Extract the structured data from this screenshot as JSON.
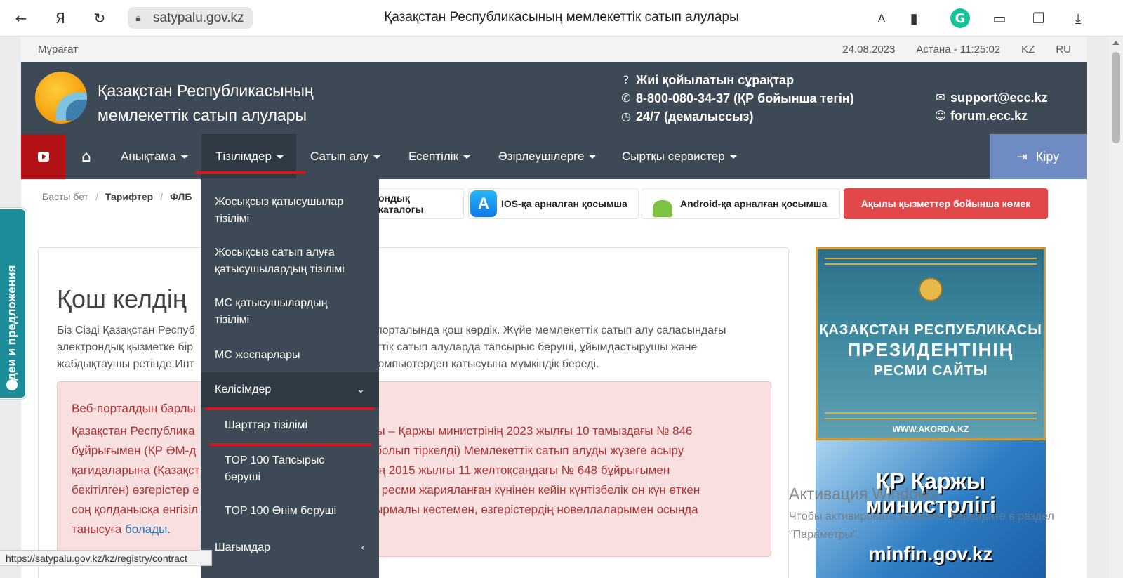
{
  "browser": {
    "url": "satypalu.gov.kz",
    "tab_title": "Қазақстан Республикасының мемлекеттік сатып алулары",
    "status_url": "https://satypalu.gov.kz/kz/registry/contract",
    "grammarly_letter": "G"
  },
  "topline": {
    "archive": "Мұрағат",
    "date": "24.08.2023",
    "time": "Астана - 11:25:02",
    "lang_kz": "KZ",
    "lang_ru": "RU"
  },
  "header": {
    "title_line1": "Қазақстан Республикасының",
    "title_line2": "мемлекеттік сатып алулары",
    "faq": "Жиі қойылатын сұрақтар",
    "phone": "8-800-080-34-37 (ҚР бойынша тегін)",
    "hours": "24/7 (демалыссыз)",
    "email": "support@ecc.kz",
    "forum": "forum.ecc.kz"
  },
  "nav": {
    "items": [
      {
        "label": "Анықтама"
      },
      {
        "label": "Тізілімдер"
      },
      {
        "label": "Сатып алу"
      },
      {
        "label": "Есептілік"
      },
      {
        "label": "Әзірлеушілерге"
      },
      {
        "label": "Сыртқы сервистер"
      }
    ],
    "login": "Кіру"
  },
  "breadcrumbs": {
    "home": "Басты бет",
    "tariffs": "Тарифтер",
    "flb": "ФЛБ"
  },
  "pills": {
    "catalog": "ондық каталогы",
    "ios": "IOS-қа арналған қосымша",
    "android": "Android-қа арналған қосымша",
    "help": "Ақылы қызметтер бойынша көмек"
  },
  "content": {
    "welcome": "Қош келдің",
    "intro_line1": "Біз Сізді Қазақстан Респуб                                                   веб-порталында қош көрдік. Жүйе мемлекеттік сатып алу саласындағы",
    "intro_line2": "электрондық қызметке бір                                                   лекеттік сатып алуларда тапсырыс беруші, ұйымдастырушы және",
    "intro_line3": "жабдықтаушы ретінде Инт                                                   ген компьютерден қатысуына мүмкіндік береді.",
    "alert_title": "Веб-порталдың барлы",
    "alert_line1": "Қазақстан Республика                                             басары – Қаржы министрінің 2023 жылғы 10 тамыздағы № 846",
    "alert_line2": "бұйрығымен (ҚР ӘМ-д                                             3283 болып тіркелді) Мемлекеттік сатып алуды жүзеге асыру",
    "alert_line3": "қағидаларына (Қазақст                                             стрінің 2015 жылғы 11 желтоқсандағы № 648 бұйрығымен",
    "alert_line4": "бекітілген) өзгерістер е                                             ашқы ресми жарияланған күнінен кейін күнтізбелік он күн өткен",
    "alert_line5": "соң қолданысқа енгізіл                                             лыстырмалы кестемен, өзгерістердің новеллаларымен осында",
    "alert_line6_pre": "танысуға ",
    "alert_link": "болады",
    "alert_line6_post": "."
  },
  "banners": {
    "akorda_l1": "ҚАЗАҚСТАН РЕСПУБЛИКАСЫ",
    "akorda_l2": "ПРЕЗИДЕНТІНІҢ",
    "akorda_l3": "РЕСМИ САЙТЫ",
    "akorda_url": "WWW.AKORDA.KZ",
    "minfin_l1": "ҚР Қаржы",
    "minfin_l2": "министрлігі",
    "minfin_l3": "minfin.gov.kz"
  },
  "activation": {
    "title": "Активация Windows",
    "text": "Чтобы активировать Windows, перейдите в раздел \"Параметры\"."
  },
  "dropdown": {
    "item1": "Жосықсыз қатысушылар тізілімі",
    "item2": "Жосықсыз сатып алуға қатысушылардың тізілімі",
    "item3": "МС қатысушылардың тізілімі",
    "item4": "МС жоспарлары",
    "open": "Келісімдер",
    "sub1": "Шарттар тізілімі",
    "sub2": "TOP 100 Тапсырыс беруші",
    "sub3": "TOP 100 Өнім беруші",
    "item5": "Шағымдар"
  },
  "side_tab": "Идеи и предложения"
}
